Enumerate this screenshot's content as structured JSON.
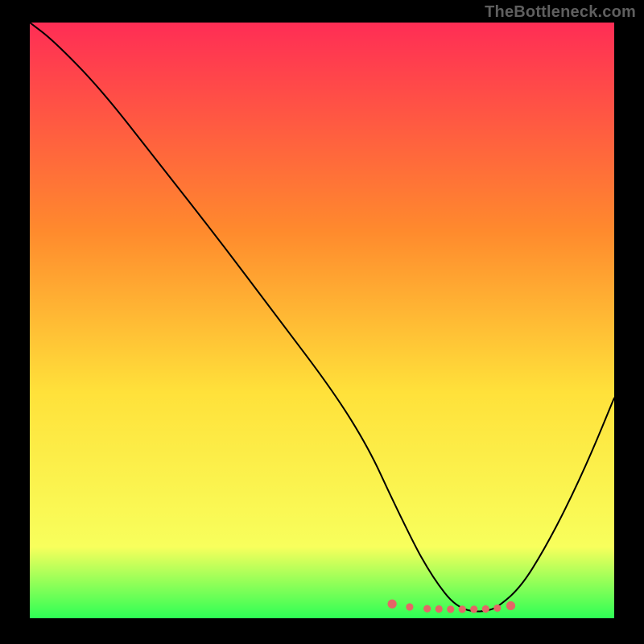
{
  "watermark": "TheBottleneck.com",
  "colors": {
    "background": "#000000",
    "watermark": "#5f5f5f",
    "curve": "#000000",
    "marker": "#e46666",
    "gradient_top": "#ff2d55",
    "gradient_mid_upper": "#ff8a2d",
    "gradient_mid": "#ffe13a",
    "gradient_mid_lower": "#f8ff5c",
    "gradient_bottom": "#2dff55"
  },
  "chart_data": {
    "type": "line",
    "title": "",
    "xlabel": "",
    "ylabel": "",
    "xlim": [
      0,
      100
    ],
    "ylim": [
      0,
      100
    ],
    "grid": false,
    "curve": {
      "name": "bottleneck-curve",
      "x": [
        0,
        4,
        12,
        22,
        32,
        42,
        52,
        58,
        62,
        66,
        68,
        70,
        72,
        74,
        76,
        78,
        80,
        84,
        88,
        92,
        96,
        100
      ],
      "y": [
        100,
        97,
        89,
        76.5,
        64,
        51,
        38,
        28.5,
        20,
        12,
        8.5,
        5.5,
        3,
        1.6,
        1.1,
        1.2,
        1.8,
        5.2,
        11.5,
        19,
        27.5,
        37
      ]
    },
    "markers": {
      "name": "optimal-range",
      "x": [
        62,
        65,
        68,
        70,
        72,
        74,
        76,
        78,
        80,
        82.3
      ],
      "y": [
        2.4,
        1.9,
        1.6,
        1.55,
        1.5,
        1.5,
        1.5,
        1.55,
        1.7,
        2.1
      ]
    }
  }
}
